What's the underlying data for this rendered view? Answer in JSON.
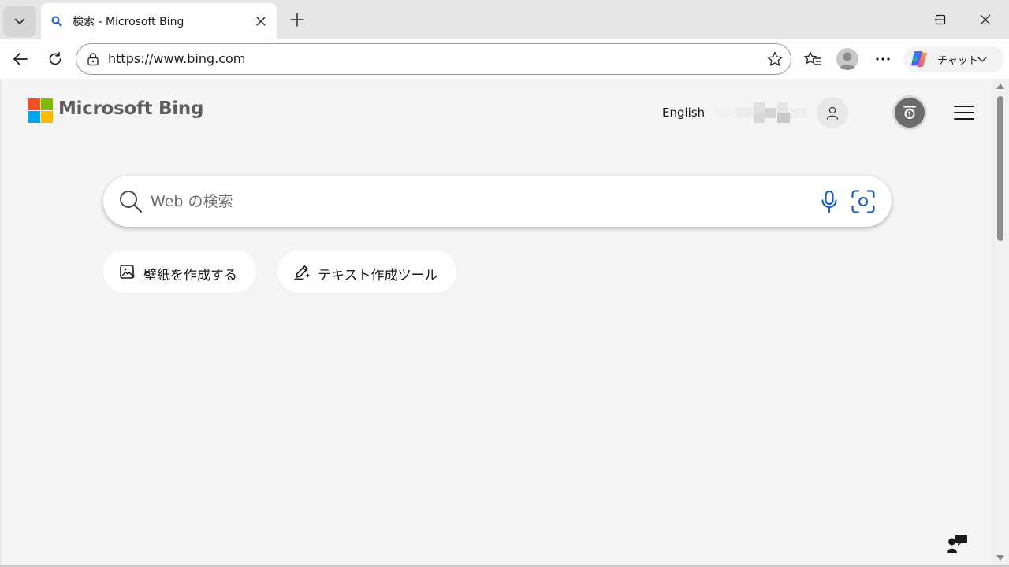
{
  "tab_strip": {
    "active_tab": {
      "title": "検索 - Microsoft Bing",
      "favicon": "search-icon"
    },
    "tab_actions_icon": "chevron-down-icon",
    "new_tab_icon": "plus-icon"
  },
  "window_controls": [
    "minimize-icon",
    "maximize-icon",
    "close-icon"
  ],
  "toolbar": {
    "back_icon": "arrow-left-icon",
    "refresh_icon": "refresh-icon",
    "url": "https://www.bing.com",
    "copilot_label": "チャット"
  },
  "bing": {
    "logo_text": "Microsoft Bing",
    "language_link": "English",
    "search_placeholder": "Web の検索",
    "pills": [
      {
        "label": "壁紙を作成する",
        "icon": "image-sparkle-icon"
      },
      {
        "label": "テキスト作成ツール",
        "icon": "pen-sparkle-icon"
      }
    ]
  },
  "colors": {
    "accent_blue": "#1a5fc8",
    "ms_red": "#f25022",
    "ms_green": "#7fba00",
    "ms_blue": "#00a4ef",
    "ms_yellow": "#ffb900"
  }
}
